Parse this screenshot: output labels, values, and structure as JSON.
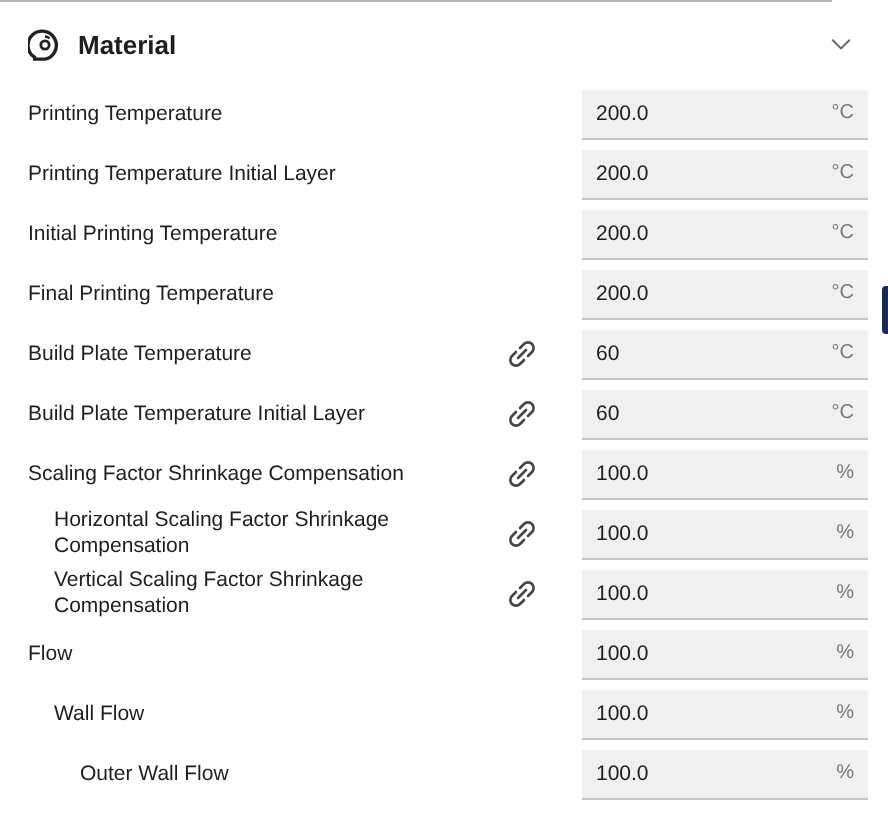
{
  "section": {
    "title": "Material",
    "expanded": true
  },
  "settings": [
    {
      "label": "Printing Temperature",
      "linked": false,
      "value": "200.0",
      "unit": "°C"
    },
    {
      "label": "Printing Temperature Initial Layer",
      "linked": false,
      "value": "200.0",
      "unit": "°C"
    },
    {
      "label": "Initial Printing Temperature",
      "linked": false,
      "value": "200.0",
      "unit": "°C"
    },
    {
      "label": "Final Printing Temperature",
      "linked": false,
      "value": "200.0",
      "unit": "°C"
    },
    {
      "label": "Build Plate Temperature",
      "linked": true,
      "value": "60",
      "unit": "°C"
    },
    {
      "label": "Build Plate Temperature Initial Layer",
      "linked": true,
      "value": "60",
      "unit": "°C"
    },
    {
      "label": "Scaling Factor Shrinkage Compensation",
      "linked": true,
      "value": "100.0",
      "unit": "%",
      "children": [
        {
          "label": "Horizontal Scaling Factor Shrinkage Compensation",
          "linked": true,
          "value": "100.0",
          "unit": "%"
        },
        {
          "label": "Vertical Scaling Factor Shrinkage Compensation",
          "linked": true,
          "value": "100.0",
          "unit": "%"
        }
      ]
    },
    {
      "label": "Flow",
      "linked": false,
      "value": "100.0",
      "unit": "%",
      "children": [
        {
          "label": "Wall Flow",
          "linked": false,
          "value": "100.0",
          "unit": "%",
          "children": [
            {
              "label": "Outer Wall Flow",
              "linked": false,
              "value": "100.0",
              "unit": "%"
            }
          ]
        }
      ]
    }
  ]
}
